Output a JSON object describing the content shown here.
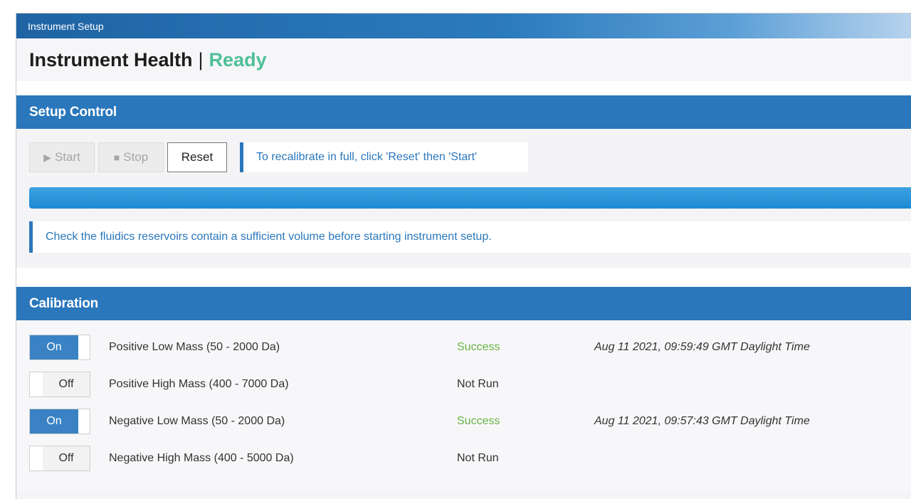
{
  "window": {
    "title": "Instrument Setup"
  },
  "health": {
    "label": "Instrument Health",
    "separator": "|",
    "status": "Ready",
    "status_color": "#4fbf9a"
  },
  "setup_control": {
    "header": "Setup Control",
    "buttons": {
      "start": {
        "label": "Start",
        "icon": "play-icon",
        "enabled": false
      },
      "stop": {
        "label": "Stop",
        "icon": "stop-icon",
        "enabled": false
      },
      "reset": {
        "label": "Reset",
        "enabled": true
      }
    },
    "hint": "To recalibrate in full, click 'Reset' then 'Start'",
    "progress_fraction": 1.0,
    "notice": "Check the fluidics reservoirs contain a sufficient volume before starting instrument setup."
  },
  "calibration": {
    "header": "Calibration",
    "rows": [
      {
        "toggle": "On",
        "state": "on",
        "label": "Positive Low Mass (50 - 2000 Da)",
        "status": "Success",
        "status_type": "success",
        "time": "Aug 11 2021, 09:59:49 GMT Daylight Time"
      },
      {
        "toggle": "Off",
        "state": "off",
        "label": "Positive High Mass (400 - 7000 Da)",
        "status": "Not Run",
        "status_type": "notrun",
        "time": ""
      },
      {
        "toggle": "On",
        "state": "on",
        "label": "Negative Low Mass (50 - 2000 Da)",
        "status": "Success",
        "status_type": "success",
        "time": "Aug 11 2021, 09:57:43 GMT Daylight Time"
      },
      {
        "toggle": "Off",
        "state": "off",
        "label": "Negative High Mass (400 - 5000 Da)",
        "status": "Not Run",
        "status_type": "notrun",
        "time": ""
      }
    ]
  },
  "colors": {
    "accent": "#2a77bb",
    "success": "#67b346"
  }
}
